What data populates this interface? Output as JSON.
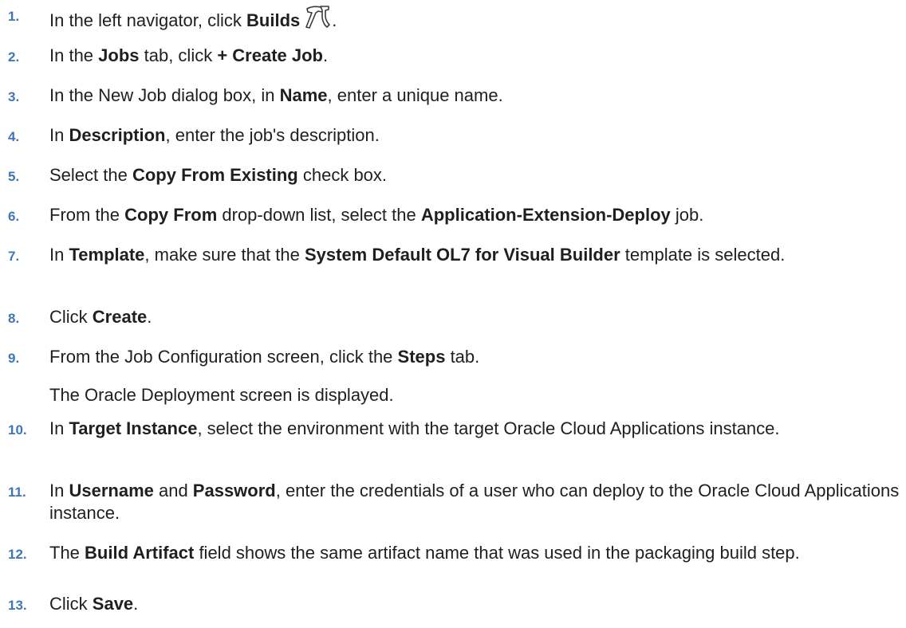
{
  "steps": [
    {
      "num": "1.",
      "parts": [
        "In the left navigator, click ",
        "Builds",
        "."
      ],
      "icon": "hammer-icon"
    },
    {
      "num": "2.",
      "parts": [
        "In the ",
        "Jobs",
        " tab, click ",
        "+ Create Job",
        "."
      ]
    },
    {
      "num": "3.",
      "parts": [
        "In the New Job dialog box, in ",
        "Name",
        ", enter a unique name."
      ]
    },
    {
      "num": "4.",
      "parts": [
        "In ",
        "Description",
        ", enter the job's description."
      ]
    },
    {
      "num": "5.",
      "parts": [
        "Select the ",
        "Copy From Existing",
        " check box."
      ]
    },
    {
      "num": "6.",
      "parts": [
        "From the ",
        "Copy From",
        " drop-down list, select the ",
        "Application-Extension-Deploy",
        " job."
      ]
    },
    {
      "num": "7.",
      "parts": [
        "In ",
        "Template",
        ", make sure that the ",
        "System Default OL7 for Visual Builder",
        " template is selected."
      ]
    },
    {
      "num": "8.",
      "parts": [
        "Click ",
        "Create",
        "."
      ]
    },
    {
      "num": "9.",
      "parts": [
        "From the Job Configuration screen, click the ",
        "Steps",
        " tab."
      ],
      "note": "The Oracle Deployment screen is displayed."
    },
    {
      "num": "10.",
      "parts": [
        "In ",
        "Target Instance",
        ", select the environment with the target Oracle Cloud Applications instance."
      ]
    },
    {
      "num": "11.",
      "parts": [
        "In ",
        "Username",
        " and ",
        "Password",
        ", enter the credentials of a user who can deploy to the Oracle Cloud Applications instance."
      ]
    },
    {
      "num": "12.",
      "parts": [
        "The ",
        "Build Artifact",
        " field shows the same artifact name that was used in the packaging build step."
      ]
    },
    {
      "num": "13.",
      "parts": [
        "Click ",
        "Save",
        "."
      ]
    }
  ]
}
